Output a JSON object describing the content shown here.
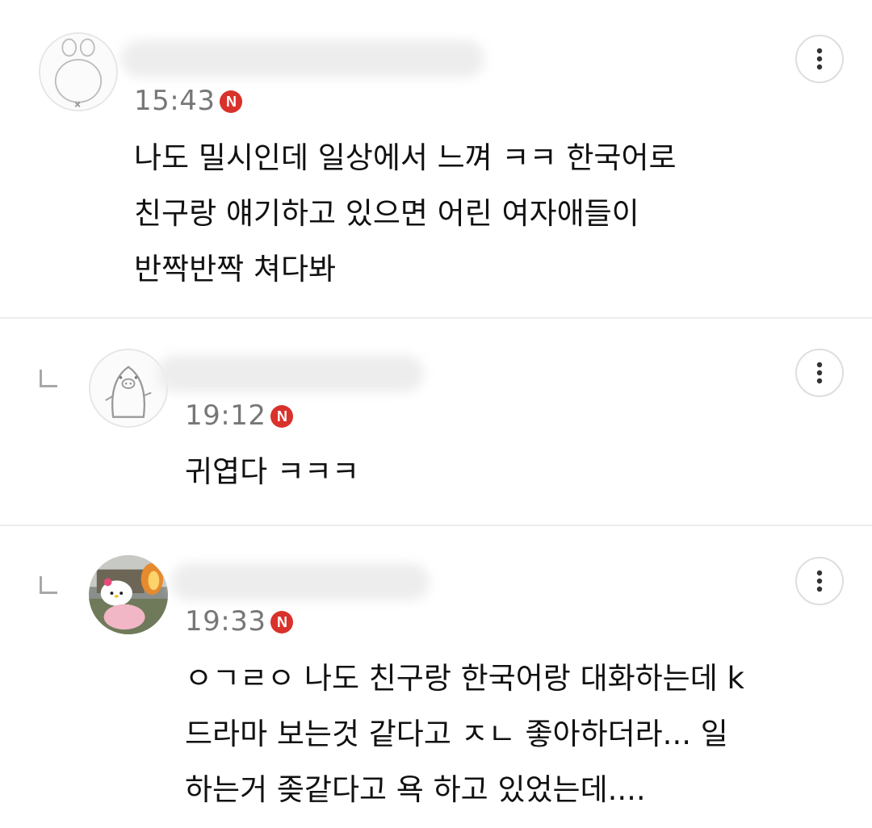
{
  "comments": [
    {
      "time": "15:43",
      "badge": "N",
      "text": "나도 밀시인데 일상에서 느껴 ㅋㅋ 한국어로\n친구랑 얘기하고 있으면 어린 여자애들이\n반짝반짝 쳐다봐",
      "is_reply": false,
      "avatar_icon": "sketch-character-avatar"
    },
    {
      "time": "19:12",
      "badge": "N",
      "text": "귀엽다 ㅋㅋㅋ",
      "is_reply": true,
      "avatar_icon": "penguin-pig-avatar"
    },
    {
      "time": "19:33",
      "badge": "N",
      "text": "ㅇㄱㄹㅇ 나도 친구랑 한국어랑 대화하는데 k\n드라마 보는것 같다고 ㅈㄴ 좋아하더라... 일\n하는거 좆같다고 욕 하고 있었는데....",
      "is_reply": true,
      "avatar_icon": "hello-kitty-photo-avatar"
    }
  ],
  "icons": {
    "more": "more-vertical-icon",
    "reply": "reply-indent-icon",
    "new_badge": "new-badge-icon"
  },
  "colors": {
    "badge_red": "#d9312b",
    "time_gray": "#777777",
    "divider": "#ececec"
  }
}
